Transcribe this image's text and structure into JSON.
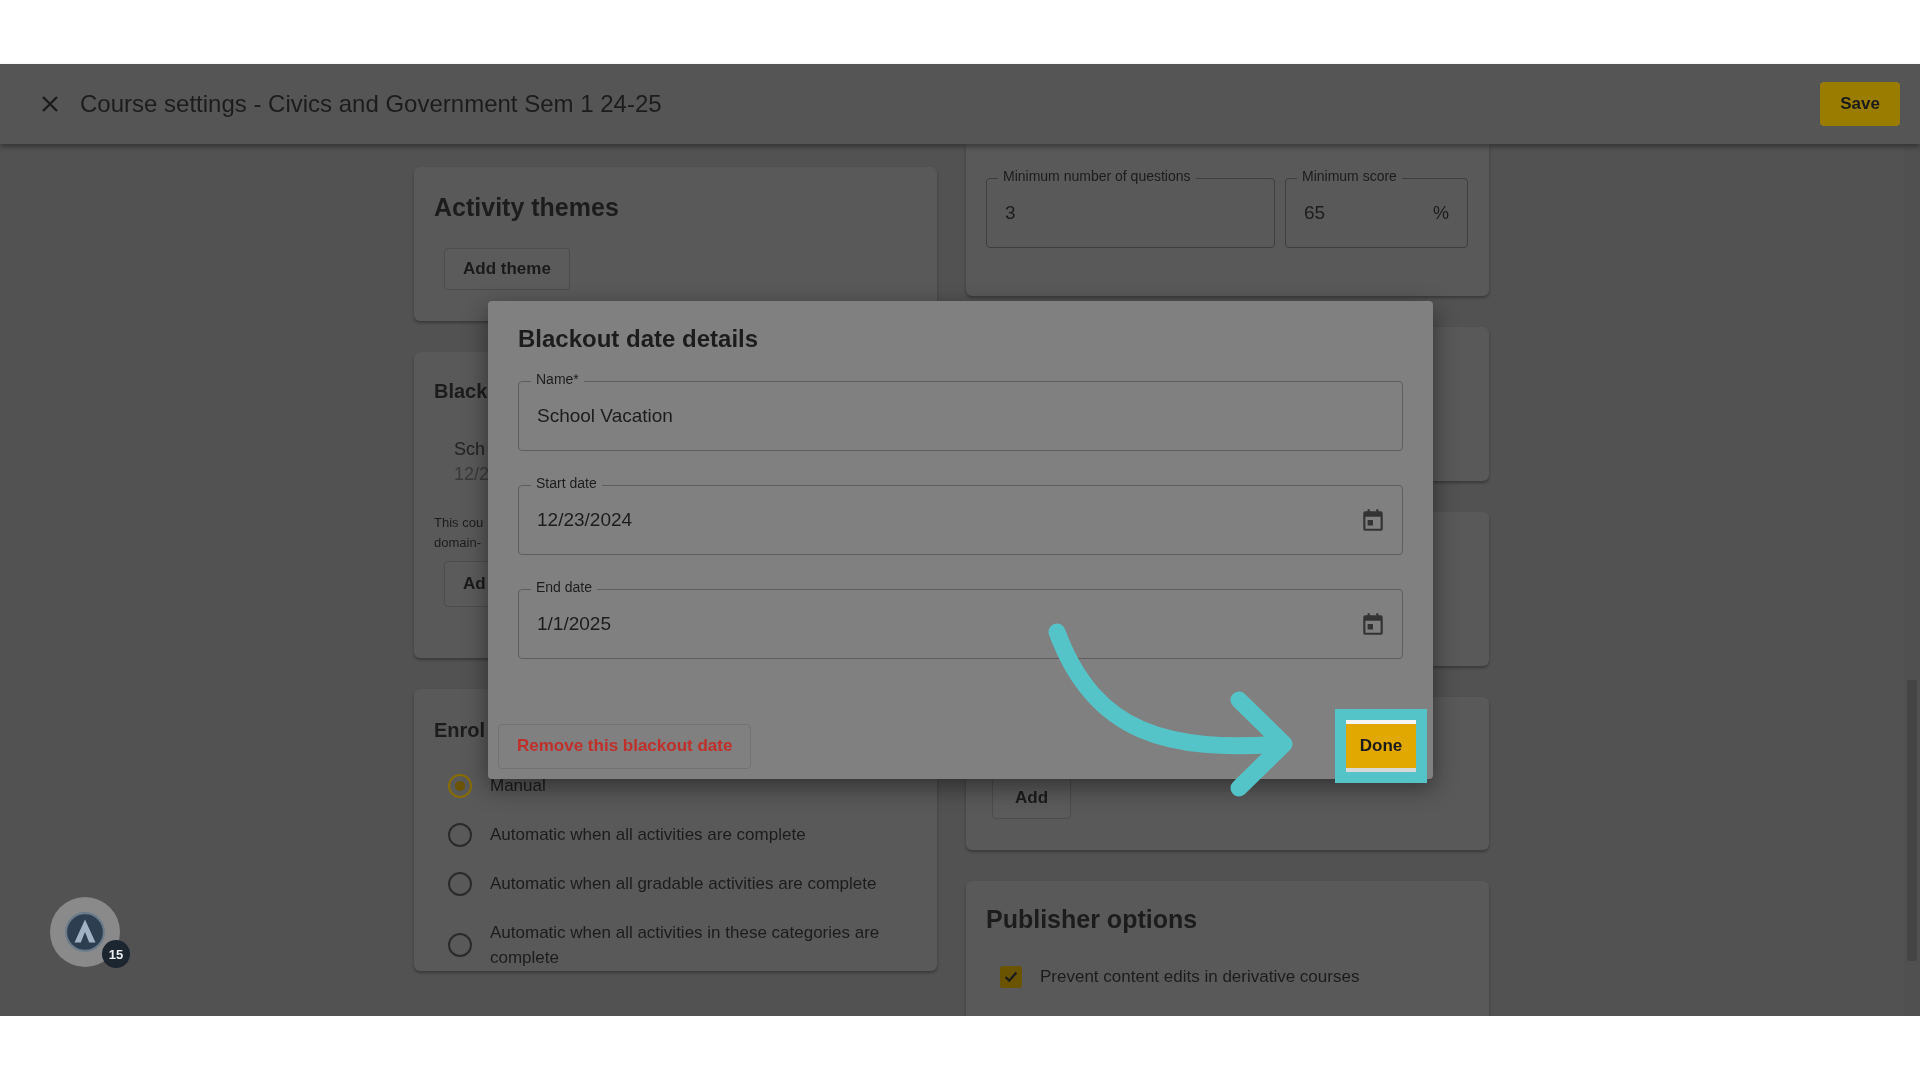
{
  "app_bar": {
    "title": "Course settings - Civics and Government Sem 1 24-25",
    "save_label": "Save"
  },
  "activity_themes": {
    "title": "Activity themes",
    "button": "Add theme"
  },
  "blackout_card": {
    "title": "Black",
    "item_name": "Sch",
    "item_date": "12/2",
    "note_lines": [
      "This cou",
      "domain-"
    ],
    "button": "Ad"
  },
  "enrollment": {
    "title": "Enrol",
    "options": [
      {
        "label": "Manual",
        "selected": true
      },
      {
        "label": "Automatic when all activities are complete",
        "selected": false
      },
      {
        "label": "Automatic when all gradable activities are complete",
        "selected": false
      },
      {
        "label": "Automatic when all activities in these categories are complete",
        "selected": false
      }
    ]
  },
  "completion_card": {
    "fields": [
      {
        "label": "Minimum number of questions",
        "value": "3"
      },
      {
        "label": "Minimum score",
        "value": "65",
        "suffix": "%"
      }
    ]
  },
  "add_card": {
    "button": "Add"
  },
  "publisher_options": {
    "title": "Publisher options",
    "options": [
      {
        "label": "Prevent content edits in derivative courses",
        "checked": true
      }
    ]
  },
  "dialog": {
    "title": "Blackout date details",
    "fields": [
      {
        "label": "Name*",
        "value": "School Vacation",
        "kind": "text"
      },
      {
        "label": "Start date",
        "value": "12/23/2024",
        "kind": "date"
      },
      {
        "label": "End date",
        "value": "1/1/2025",
        "kind": "date"
      }
    ],
    "remove_button": "Remove this blackout date",
    "done_button": "Done"
  },
  "help_widget": {
    "badge": "15"
  }
}
